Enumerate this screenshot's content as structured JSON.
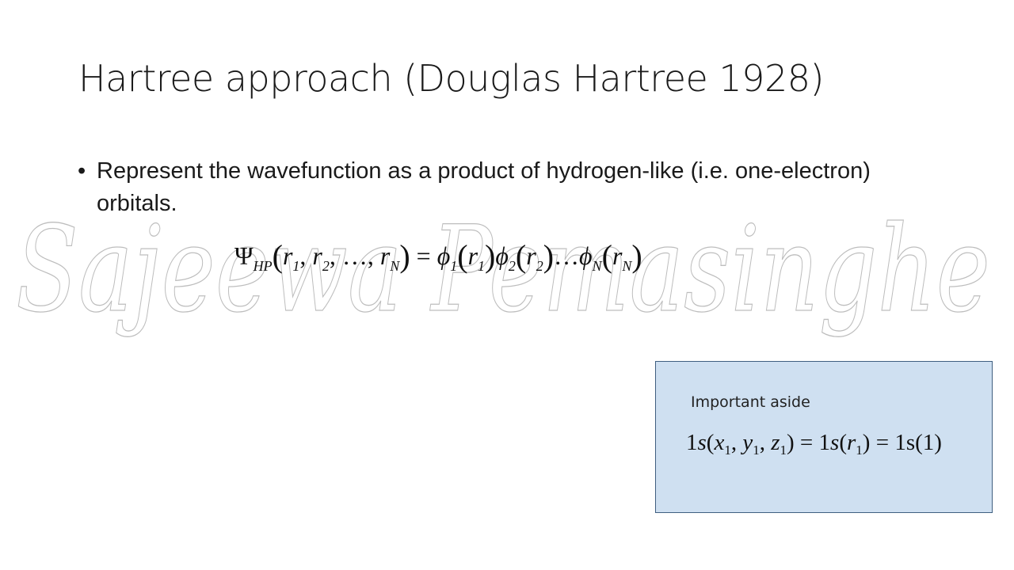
{
  "slide": {
    "title": "Hartree approach (Douglas Hartree 1928)",
    "bullet_marker": "•",
    "bullet_text": "Represent the wavefunction as a product of hydrogen-like (i.e. one-electron) orbitals.",
    "watermark_text": "Sajeewa Pemasinghe"
  },
  "equation": {
    "lhs_symbol": "Ψ",
    "lhs_subscript": "HP",
    "lhs_args": [
      "r1",
      "r2",
      "…",
      "rN"
    ],
    "equals": "=",
    "rhs_terms": [
      {
        "symbol": "ϕ",
        "index": "1",
        "arg": "r",
        "arg_index": "1"
      },
      {
        "symbol": "ϕ",
        "index": "2",
        "arg": "r",
        "arg_index": "2"
      },
      {
        "symbol": "…",
        "index": "",
        "arg": "",
        "arg_index": ""
      },
      {
        "symbol": "ϕ",
        "index": "N",
        "arg": "r",
        "arg_index": "N"
      }
    ]
  },
  "aside": {
    "label": "Important aside",
    "formula_parts": {
      "a": "1",
      "s": "s",
      "x": "x",
      "x_i": "1",
      "y": "y",
      "y_i": "1",
      "z": "z",
      "z_i": "1",
      "r": "r",
      "r_i": "1",
      "end": "1s(1)"
    }
  },
  "colors": {
    "aside_fill": "#cfe0f1",
    "aside_border": "#3f5f80",
    "text": "#1a1a1a"
  }
}
